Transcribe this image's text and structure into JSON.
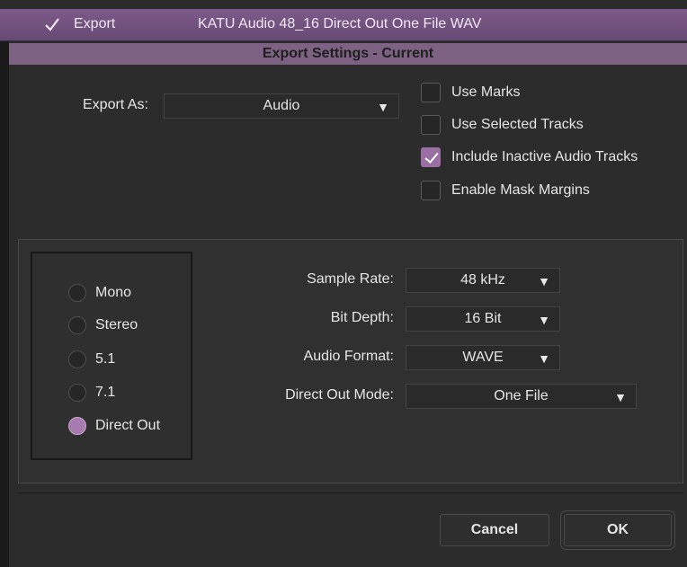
{
  "titlebar": {
    "section_label": "Export",
    "preset_name": "KATU Audio 48_16 Direct Out One File WAV"
  },
  "header": {
    "title": "Export Settings - Current"
  },
  "export_as": {
    "label": "Export As:",
    "value": "Audio"
  },
  "options": [
    {
      "label": "Use Marks",
      "checked": false
    },
    {
      "label": "Use Selected Tracks",
      "checked": false
    },
    {
      "label": "Include Inactive Audio Tracks",
      "checked": true
    },
    {
      "label": "Enable Mask Margins",
      "checked": false
    }
  ],
  "channels": [
    {
      "label": "Mono",
      "selected": false
    },
    {
      "label": "Stereo",
      "selected": false
    },
    {
      "label": "5.1",
      "selected": false
    },
    {
      "label": "7.1",
      "selected": false
    },
    {
      "label": "Direct Out",
      "selected": true
    }
  ],
  "fields": {
    "sample_rate": {
      "label": "Sample Rate:",
      "value": "48 kHz"
    },
    "bit_depth": {
      "label": "Bit Depth:",
      "value": "16 Bit"
    },
    "audio_format": {
      "label": "Audio Format:",
      "value": "WAVE"
    },
    "direct_out_mode": {
      "label": "Direct Out Mode:",
      "value": "One File"
    }
  },
  "buttons": {
    "cancel": "Cancel",
    "ok": "OK"
  },
  "colors": {
    "accent": "#9a6fa3",
    "titlebar": "#7d5a8a",
    "header": "#7d6283"
  }
}
